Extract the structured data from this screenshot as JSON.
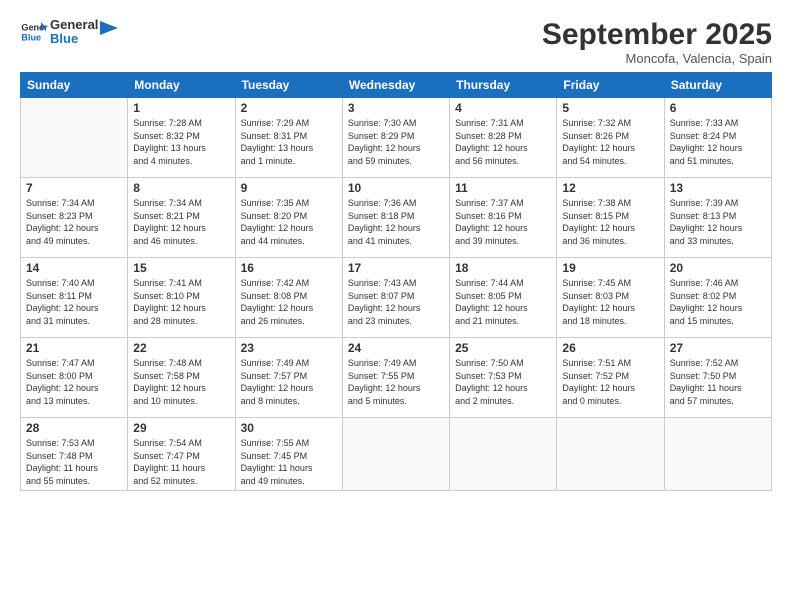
{
  "logo": {
    "text_general": "General",
    "text_blue": "Blue"
  },
  "header": {
    "month": "September 2025",
    "location": "Moncofa, Valencia, Spain"
  },
  "weekdays": [
    "Sunday",
    "Monday",
    "Tuesday",
    "Wednesday",
    "Thursday",
    "Friday",
    "Saturday"
  ],
  "weeks": [
    [
      {
        "day": "",
        "info": ""
      },
      {
        "day": "1",
        "info": "Sunrise: 7:28 AM\nSunset: 8:32 PM\nDaylight: 13 hours\nand 4 minutes."
      },
      {
        "day": "2",
        "info": "Sunrise: 7:29 AM\nSunset: 8:31 PM\nDaylight: 13 hours\nand 1 minute."
      },
      {
        "day": "3",
        "info": "Sunrise: 7:30 AM\nSunset: 8:29 PM\nDaylight: 12 hours\nand 59 minutes."
      },
      {
        "day": "4",
        "info": "Sunrise: 7:31 AM\nSunset: 8:28 PM\nDaylight: 12 hours\nand 56 minutes."
      },
      {
        "day": "5",
        "info": "Sunrise: 7:32 AM\nSunset: 8:26 PM\nDaylight: 12 hours\nand 54 minutes."
      },
      {
        "day": "6",
        "info": "Sunrise: 7:33 AM\nSunset: 8:24 PM\nDaylight: 12 hours\nand 51 minutes."
      }
    ],
    [
      {
        "day": "7",
        "info": "Sunrise: 7:34 AM\nSunset: 8:23 PM\nDaylight: 12 hours\nand 49 minutes."
      },
      {
        "day": "8",
        "info": "Sunrise: 7:34 AM\nSunset: 8:21 PM\nDaylight: 12 hours\nand 46 minutes."
      },
      {
        "day": "9",
        "info": "Sunrise: 7:35 AM\nSunset: 8:20 PM\nDaylight: 12 hours\nand 44 minutes."
      },
      {
        "day": "10",
        "info": "Sunrise: 7:36 AM\nSunset: 8:18 PM\nDaylight: 12 hours\nand 41 minutes."
      },
      {
        "day": "11",
        "info": "Sunrise: 7:37 AM\nSunset: 8:16 PM\nDaylight: 12 hours\nand 39 minutes."
      },
      {
        "day": "12",
        "info": "Sunrise: 7:38 AM\nSunset: 8:15 PM\nDaylight: 12 hours\nand 36 minutes."
      },
      {
        "day": "13",
        "info": "Sunrise: 7:39 AM\nSunset: 8:13 PM\nDaylight: 12 hours\nand 33 minutes."
      }
    ],
    [
      {
        "day": "14",
        "info": "Sunrise: 7:40 AM\nSunset: 8:11 PM\nDaylight: 12 hours\nand 31 minutes."
      },
      {
        "day": "15",
        "info": "Sunrise: 7:41 AM\nSunset: 8:10 PM\nDaylight: 12 hours\nand 28 minutes."
      },
      {
        "day": "16",
        "info": "Sunrise: 7:42 AM\nSunset: 8:08 PM\nDaylight: 12 hours\nand 26 minutes."
      },
      {
        "day": "17",
        "info": "Sunrise: 7:43 AM\nSunset: 8:07 PM\nDaylight: 12 hours\nand 23 minutes."
      },
      {
        "day": "18",
        "info": "Sunrise: 7:44 AM\nSunset: 8:05 PM\nDaylight: 12 hours\nand 21 minutes."
      },
      {
        "day": "19",
        "info": "Sunrise: 7:45 AM\nSunset: 8:03 PM\nDaylight: 12 hours\nand 18 minutes."
      },
      {
        "day": "20",
        "info": "Sunrise: 7:46 AM\nSunset: 8:02 PM\nDaylight: 12 hours\nand 15 minutes."
      }
    ],
    [
      {
        "day": "21",
        "info": "Sunrise: 7:47 AM\nSunset: 8:00 PM\nDaylight: 12 hours\nand 13 minutes."
      },
      {
        "day": "22",
        "info": "Sunrise: 7:48 AM\nSunset: 7:58 PM\nDaylight: 12 hours\nand 10 minutes."
      },
      {
        "day": "23",
        "info": "Sunrise: 7:49 AM\nSunset: 7:57 PM\nDaylight: 12 hours\nand 8 minutes."
      },
      {
        "day": "24",
        "info": "Sunrise: 7:49 AM\nSunset: 7:55 PM\nDaylight: 12 hours\nand 5 minutes."
      },
      {
        "day": "25",
        "info": "Sunrise: 7:50 AM\nSunset: 7:53 PM\nDaylight: 12 hours\nand 2 minutes."
      },
      {
        "day": "26",
        "info": "Sunrise: 7:51 AM\nSunset: 7:52 PM\nDaylight: 12 hours\nand 0 minutes."
      },
      {
        "day": "27",
        "info": "Sunrise: 7:52 AM\nSunset: 7:50 PM\nDaylight: 11 hours\nand 57 minutes."
      }
    ],
    [
      {
        "day": "28",
        "info": "Sunrise: 7:53 AM\nSunset: 7:48 PM\nDaylight: 11 hours\nand 55 minutes."
      },
      {
        "day": "29",
        "info": "Sunrise: 7:54 AM\nSunset: 7:47 PM\nDaylight: 11 hours\nand 52 minutes."
      },
      {
        "day": "30",
        "info": "Sunrise: 7:55 AM\nSunset: 7:45 PM\nDaylight: 11 hours\nand 49 minutes."
      },
      {
        "day": "",
        "info": ""
      },
      {
        "day": "",
        "info": ""
      },
      {
        "day": "",
        "info": ""
      },
      {
        "day": "",
        "info": ""
      }
    ]
  ]
}
